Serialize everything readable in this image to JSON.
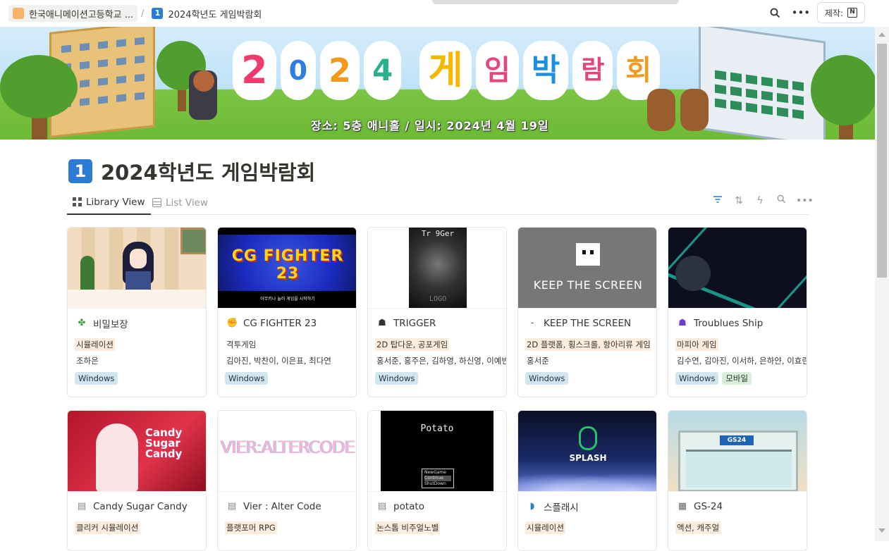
{
  "topbar": {
    "crumbs": [
      "한국애니메이션고등학교 ...",
      "2024학년도 게임박람회"
    ],
    "crumb_num": "1",
    "made_label": "제작:",
    "notion_letter": "N"
  },
  "banner": {
    "title_chars": [
      "2",
      "0",
      "2",
      "4",
      "게",
      "임",
      "박",
      "람",
      "회"
    ],
    "subtitle": "장소: 5층 애니홀 / 일시: 2024년 4월 19일"
  },
  "page": {
    "icon": "1",
    "title": "2024학년도 게임박람회"
  },
  "views": [
    {
      "label": "Library View",
      "active": true
    },
    {
      "label": "List View",
      "active": false
    }
  ],
  "thumbs": {
    "cg": "CG FIGHTER 23",
    "cg_sub": "아무키나 눌러 게임을 시작하기",
    "trigger": "Tr 9Ger",
    "trigger_low": "LOGO",
    "keep": "KEEP THE SCREEN",
    "candy": "Candy Sugar Candy",
    "vier": "VIER:ALTERCODE",
    "potato": "Potato",
    "potato_menu": [
      "NewGame",
      "Continue",
      "ShutDown"
    ],
    "splash": "SPLASH",
    "gs": "GS24"
  },
  "cards": [
    {
      "name": "비밀보장",
      "icon": "✤",
      "iconColor": "#3a9a3a",
      "genre": "시뮬레이션",
      "members": "조하은",
      "tags": [
        "Windows"
      ]
    },
    {
      "name": "CG FIGHTER 23",
      "icon": "✊",
      "iconColor": "#d8a12a",
      "genre": "격투게임",
      "members": "김아진, 박찬이, 이은표, 최다연",
      "tags": [
        "Windows"
      ],
      "plain": true
    },
    {
      "name": "TRIGGER",
      "icon": "☗",
      "iconColor": "#333",
      "genre": "2D 탑다운, 공포게임",
      "members": "홍서준, 홍주은, 김하영, 하신영, 이예빈,",
      "tags": [
        "Windows"
      ]
    },
    {
      "name": "KEEP THE SCREEN",
      "icon": "-",
      "iconColor": "#555",
      "genre": "2D 플랫폼, 횡스크롤, 항아리류 게임",
      "members": "홍서준",
      "tags": [
        "Windows"
      ]
    },
    {
      "name": "Troublues Ship",
      "icon": "☗",
      "iconColor": "#6a3fc9",
      "genre": "마피아 게임",
      "members": "김수연, 김아진, 이서하, 은하얀, 이효린",
      "tags": [
        "Windows",
        "모바일"
      ]
    },
    {
      "name": "Candy Sugar Candy",
      "icon": "▤",
      "iconColor": "#888",
      "genre": "클리커 시뮬레이션"
    },
    {
      "name": "Vier : Alter Code",
      "icon": "▤",
      "iconColor": "#888",
      "genre": "플랫포머 RPG"
    },
    {
      "name": "potato",
      "icon": "▤",
      "iconColor": "#888",
      "genre": "논스톱 비주얼노벨"
    },
    {
      "name": "스플래시",
      "icon": "◗",
      "iconColor": "#2a7fd4",
      "genre": "시뮬레이션"
    },
    {
      "name": "GS-24",
      "icon": "▦",
      "iconColor": "#666",
      "genre": "액션, 캐주얼"
    }
  ]
}
